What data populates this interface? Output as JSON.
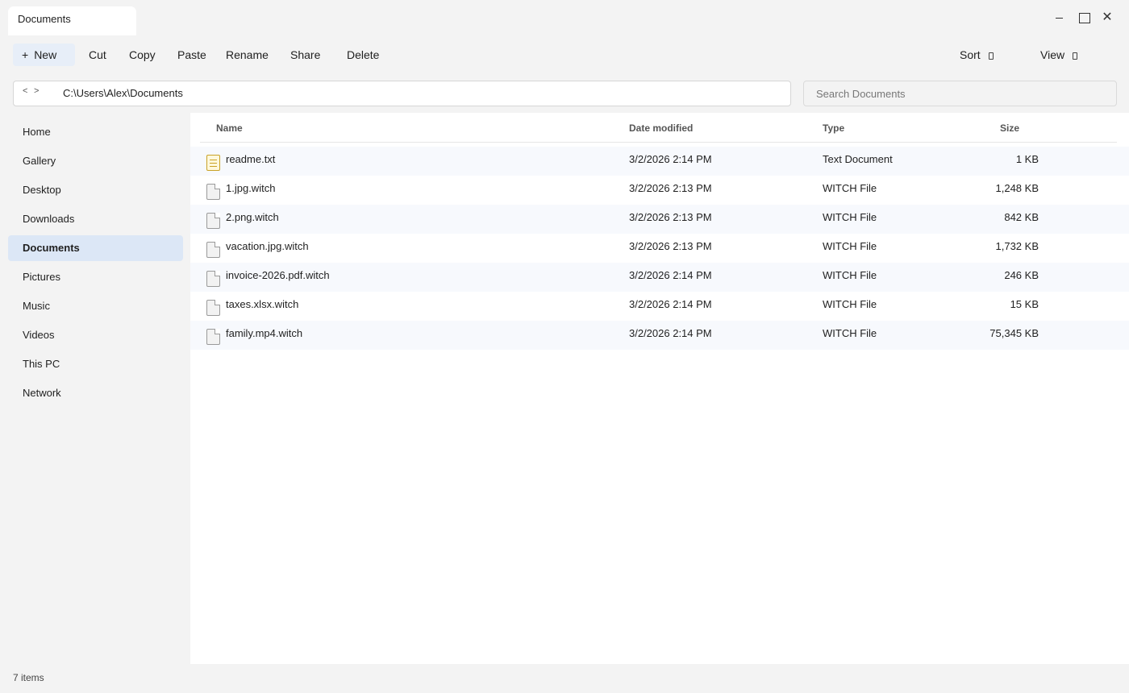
{
  "window": {
    "tab_title": "Documents"
  },
  "toolbar": {
    "new_plus": "+",
    "new_label": "New",
    "cut_label": "Cut",
    "copy_label": "Copy",
    "paste_label": "Paste",
    "rename_label": "Rename",
    "share_label": "Share",
    "delete_label": "Delete",
    "sort_label": "Sort",
    "view_label": "View"
  },
  "address": {
    "back": "<",
    "forward": ">",
    "path": "C:\\Users\\Alex\\Documents"
  },
  "search": {
    "placeholder": "Search Documents"
  },
  "sidebar": {
    "items": [
      {
        "label": "Home"
      },
      {
        "label": "Gallery"
      },
      {
        "label": "Desktop"
      },
      {
        "label": "Downloads"
      },
      {
        "label": "Documents",
        "active": true
      },
      {
        "label": "Pictures"
      },
      {
        "label": "Music"
      },
      {
        "label": "Videos"
      },
      {
        "label": "This PC"
      },
      {
        "label": "Network"
      }
    ]
  },
  "columns": {
    "name": "Name",
    "date": "Date modified",
    "type": "Type",
    "size": "Size"
  },
  "files": [
    {
      "name": "readme.txt",
      "date": "3/2/2026 2:14 PM",
      "type": "Text Document",
      "size": "1 KB",
      "icon": "text-file-icon"
    },
    {
      "name": "1.jpg.witch",
      "date": "3/2/2026 2:13 PM",
      "type": "WITCH File",
      "size": "1,248 KB",
      "icon": "file-icon"
    },
    {
      "name": "2.png.witch",
      "date": "3/2/2026 2:13 PM",
      "type": "WITCH File",
      "size": "842 KB",
      "icon": "file-icon"
    },
    {
      "name": "vacation.jpg.witch",
      "date": "3/2/2026 2:13 PM",
      "type": "WITCH File",
      "size": "1,732 KB",
      "icon": "file-icon"
    },
    {
      "name": "invoice-2026.pdf.witch",
      "date": "3/2/2026 2:14 PM",
      "type": "WITCH File",
      "size": "246 KB",
      "icon": "file-icon"
    },
    {
      "name": "taxes.xlsx.witch",
      "date": "3/2/2026 2:14 PM",
      "type": "WITCH File",
      "size": "15 KB",
      "icon": "file-icon"
    },
    {
      "name": "family.mp4.witch",
      "date": "3/2/2026 2:14 PM",
      "type": "WITCH File",
      "size": "75,345 KB",
      "icon": "file-icon"
    }
  ],
  "status": {
    "items_count": "7 items"
  }
}
